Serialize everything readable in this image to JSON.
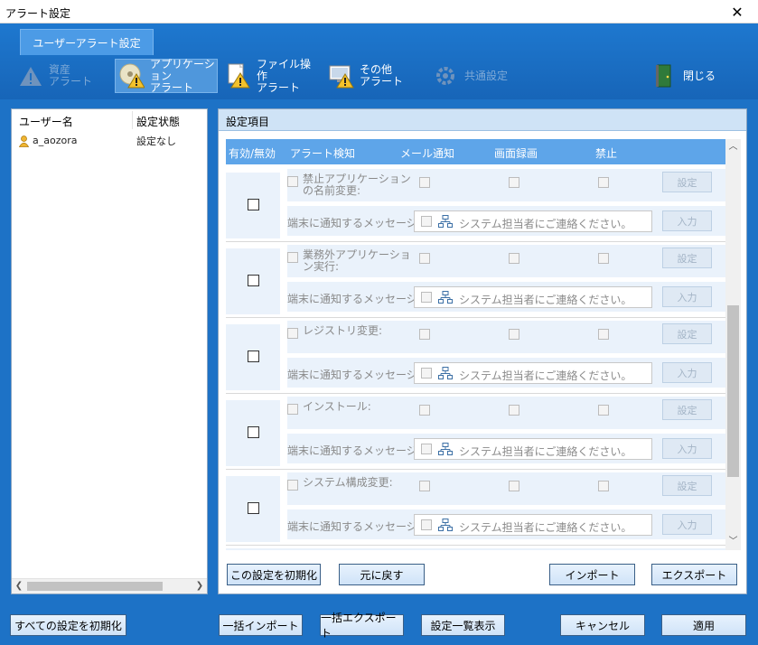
{
  "window": {
    "title": "アラート設定",
    "close_glyph": "✕"
  },
  "ribbon": {
    "tab": "ユーザーアラート設定",
    "buttons": [
      {
        "line1": "資産",
        "line2": "アラート",
        "icon": "warning-icon",
        "state": "disabled"
      },
      {
        "line1": "アプリケーション",
        "line2": "アラート",
        "icon": "cd-warning-icon",
        "state": "active"
      },
      {
        "line1": "ファイル操作",
        "line2": "アラート",
        "icon": "file-warning-icon",
        "state": "normal"
      },
      {
        "line1": "その他",
        "line2": "アラート",
        "icon": "monitor-warning-icon",
        "state": "normal"
      },
      {
        "line1": "共通設定",
        "line2": "",
        "icon": "gear-icon",
        "state": "disabled"
      },
      {
        "line1": "閉じる",
        "line2": "",
        "icon": "door-icon",
        "state": "normal"
      }
    ]
  },
  "user_list": {
    "col_user": "ユーザー名",
    "col_status": "設定状態",
    "rows": [
      {
        "name": "a_aozora",
        "status": "設定なし"
      }
    ]
  },
  "settings": {
    "header": "設定項目",
    "columns": {
      "enable": "有効/無効",
      "alert": "アラート検知",
      "mail": "メール通知",
      "record": "画面録画",
      "prohibit": "禁止"
    },
    "message_label": "端末に通知するメッセージ:",
    "set_button": "設定",
    "input_button": "入力",
    "groups": [
      {
        "name": "禁止アプリケーションの名前変更:",
        "message": "システム担当者にご連絡ください。"
      },
      {
        "name": "業務外アプリケーション実行:",
        "message": "システム担当者にご連絡ください。"
      },
      {
        "name": "レジストリ変更:",
        "message": "システム担当者にご連絡ください。"
      },
      {
        "name": "インストール:",
        "message": "システム担当者にご連絡ください。"
      },
      {
        "name": "システム構成変更:",
        "message": "システム担当者にご連絡ください。"
      }
    ],
    "buttons": {
      "reset": "この設定を初期化",
      "revert": "元に戻す",
      "import": "インポート",
      "export": "エクスポート"
    }
  },
  "footer": {
    "reset_all": "すべての設定を初期化",
    "bulk_import": "一括インポート",
    "bulk_export": "一括エクスポート",
    "list": "設定一覧表示",
    "cancel": "キャンセル",
    "apply": "適用"
  },
  "colors": {
    "accent": "#1d72c6",
    "header_blue": "#5ea5e9",
    "row_bg": "#eaf2fb"
  }
}
